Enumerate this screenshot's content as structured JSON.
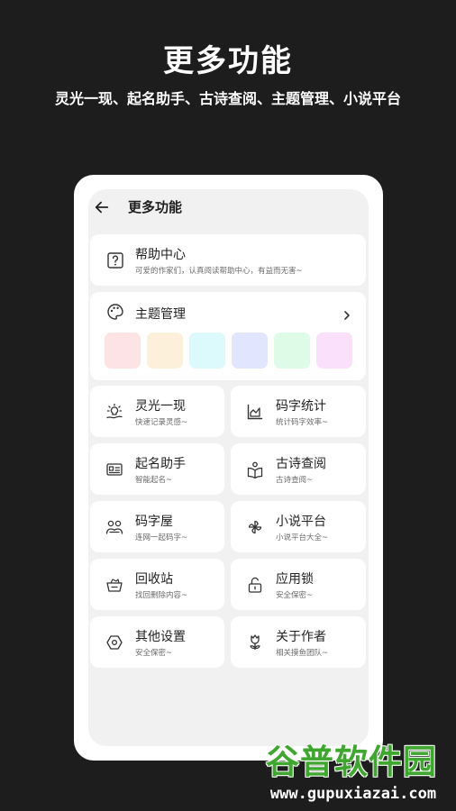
{
  "promo": {
    "title": "更多功能",
    "subtitle": "灵光一现、起名助手、古诗查阅、主题管理、小说平台"
  },
  "screen": {
    "back_icon": "arrow-left-icon",
    "title": "更多功能"
  },
  "help": {
    "icon": "question-square-icon",
    "title": "帮助中心",
    "subtitle": "可爱的作家们，认真阅读帮助中心，有益而无害~"
  },
  "theme": {
    "icon": "palette-icon",
    "title": "主题管理",
    "chevron": "chevron-right-icon",
    "swatches": [
      "#fde3e3",
      "#fdf0db",
      "#dcf9fb",
      "#e1e5fd",
      "#ddfbe7",
      "#fbe0fc"
    ]
  },
  "grid": [
    {
      "icon": "lightbulb-hand-icon",
      "title": "灵光一现",
      "subtitle": "快速记录灵感~"
    },
    {
      "icon": "chart-icon",
      "title": "码字统计",
      "subtitle": "统计码字效率~"
    },
    {
      "icon": "id-card-icon",
      "title": "起名助手",
      "subtitle": "智能起名~"
    },
    {
      "icon": "book-reader-icon",
      "title": "古诗查阅",
      "subtitle": "古诗查阅~"
    },
    {
      "icon": "people-icon",
      "title": "码字屋",
      "subtitle": "连网一起码字~"
    },
    {
      "icon": "windmill-icon",
      "title": "小说平台",
      "subtitle": "小说平台大全~"
    },
    {
      "icon": "recycle-basket-icon",
      "title": "回收站",
      "subtitle": "找回删除内容~"
    },
    {
      "icon": "unlock-icon",
      "title": "应用锁",
      "subtitle": "安全保密~"
    },
    {
      "icon": "hexagon-gear-icon",
      "title": "其他设置",
      "subtitle": "安全保密~"
    },
    {
      "icon": "tulip-icon",
      "title": "关于作者",
      "subtitle": "相关摸鱼团队~"
    }
  ],
  "watermark": {
    "brand": "谷普软件园",
    "url": "www.gupuxiazai.com"
  }
}
